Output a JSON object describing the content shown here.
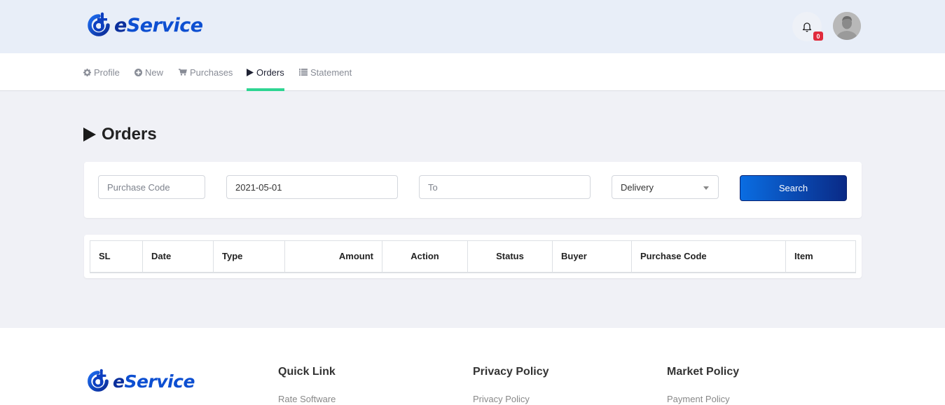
{
  "header": {
    "brand": {
      "prefix": "e",
      "name": "Service"
    },
    "notifications": {
      "icon": "bell-icon",
      "count": "0"
    },
    "avatar": {
      "icon": "user-avatar"
    }
  },
  "nav": {
    "items": [
      {
        "label": "Profile",
        "icon": "gear-icon",
        "active": false
      },
      {
        "label": "New",
        "icon": "plus-circle-icon",
        "active": false
      },
      {
        "label": "Purchases",
        "icon": "cart-icon",
        "active": false
      },
      {
        "label": "Orders",
        "icon": "play-icon",
        "active": true
      },
      {
        "label": "Statement",
        "icon": "list-icon",
        "active": false
      }
    ]
  },
  "page": {
    "title": "Orders"
  },
  "filters": {
    "purchase_code": {
      "placeholder": "Purchase Code",
      "value": ""
    },
    "from_date": {
      "value": "2021-05-01"
    },
    "to_date": {
      "placeholder": "To",
      "value": ""
    },
    "type_select": {
      "selected": "Delivery"
    },
    "search_label": "Search"
  },
  "table": {
    "columns": [
      "SL",
      "Date",
      "Type",
      "Amount",
      "Action",
      "Status",
      "Buyer",
      "Purchase Code",
      "Item"
    ],
    "rows": []
  },
  "footer": {
    "brand": {
      "prefix": "e",
      "name": "Service"
    },
    "columns": [
      {
        "title": "Quick Link",
        "links": [
          "Rate Software"
        ]
      },
      {
        "title": "Privacy Policy",
        "links": [
          "Privacy Policy"
        ]
      },
      {
        "title": "Market Policy",
        "links": [
          "Payment Policy"
        ]
      }
    ]
  },
  "colors": {
    "brand_blue": "#0d4fd1",
    "active_tab_underline": "#2ed592",
    "badge_red": "#e02b3c",
    "search_gradient_start": "#0a6de2",
    "search_gradient_end": "#0a2a86"
  }
}
